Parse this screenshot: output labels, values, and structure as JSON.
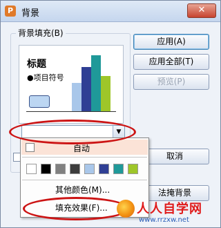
{
  "window": {
    "title": "背景",
    "close_symbol": "✕",
    "app_icon_glyph": "P"
  },
  "group": {
    "label": "背景填充(B)"
  },
  "preview": {
    "title": "标题",
    "bullet": "●项目符号"
  },
  "buttons": {
    "apply": "应用(A)",
    "apply_all": "应用全部(T)",
    "preview": "预览(P)",
    "cancel": "取消",
    "ignore_master_partial": "法掩背景"
  },
  "combo": {
    "arrow": "▼"
  },
  "dropdown": {
    "auto_label": "自动",
    "swatch_colors": [
      "#ffffff",
      "#000000",
      "#808080",
      "#3c3c3c",
      "#a9c7ea",
      "#2f3f94",
      "#1f9999",
      "#9ec629"
    ],
    "more_colors": "其他颜色(M)...",
    "fill_effects": "填充效果(F)..."
  },
  "watermark": {
    "text": "人人自学网",
    "url": "www.rrzxw.net"
  }
}
